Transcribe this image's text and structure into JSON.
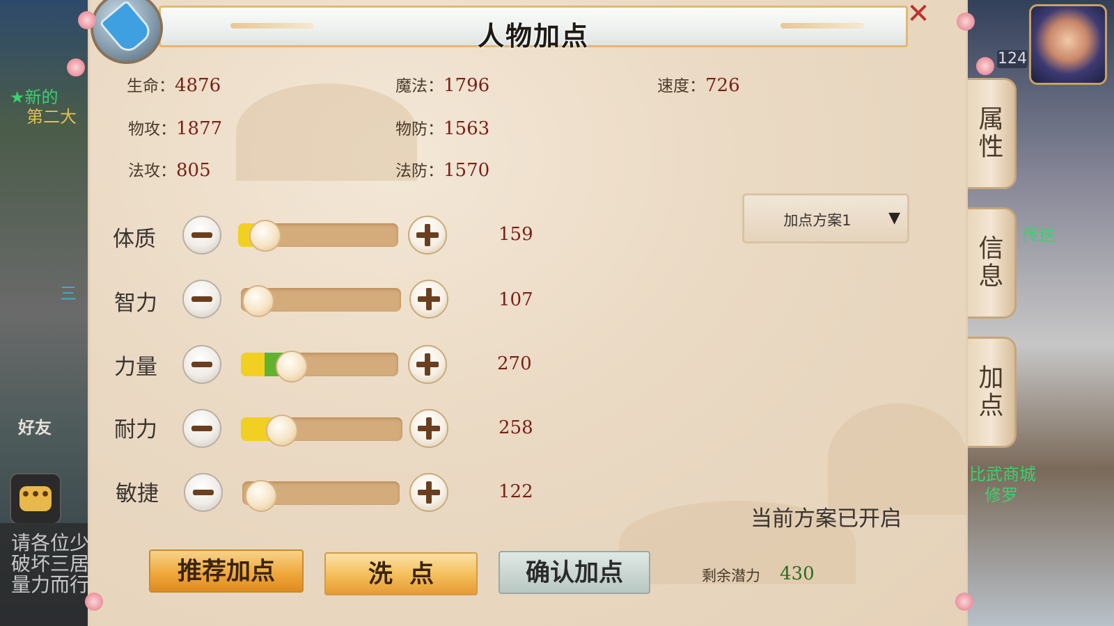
{
  "title": "人物加点",
  "stats": [
    {
      "label": "生命：",
      "value": "4876"
    },
    {
      "label": "魔法：",
      "value": "1796"
    },
    {
      "label": "速度：",
      "value": "726"
    },
    {
      "label": "物攻：",
      "value": "1877"
    },
    {
      "label": "物防：",
      "value": "1563"
    },
    {
      "label": "法攻：",
      "value": "805"
    },
    {
      "label": "法防：",
      "value": "1570"
    }
  ],
  "attributes": [
    {
      "label": "体质",
      "value": "159",
      "level": 0.18
    },
    {
      "label": "智力",
      "value": "107",
      "level": 0.11
    },
    {
      "label": "力量",
      "value": "270",
      "level": 0.33
    },
    {
      "label": "耐力",
      "value": "258",
      "level": 0.26
    },
    {
      "label": "敏捷",
      "value": "122",
      "level": 0.12
    }
  ],
  "scheme_dropdown": {
    "selected": "加点方案1",
    "arrow": "▼"
  },
  "plan_status": "当前方案已开启",
  "remaining": {
    "label": "剩余潜力",
    "value": "430"
  },
  "buttons": {
    "recommend": "推荐加点",
    "reset": "洗  点",
    "confirm": "确认加点"
  },
  "side_tabs": [
    "属性",
    "信息",
    "加点"
  ],
  "close_symbol": "✕",
  "hud": {
    "level": "124",
    "friend_label": "好友",
    "chat_icon": "•••",
    "chat_lines": [
      "请各位少",
      "破坏三居",
      "量力而行"
    ],
    "bg_texts": [
      "★新的",
      "第二大",
      "三",
      "传送",
      "比武商城",
      "修罗"
    ]
  },
  "colors": {
    "value_red": "#7a1f16",
    "yellow_fill": "#f2d021",
    "green_fill": "#62b232",
    "orange_button": "#f0a93c"
  }
}
